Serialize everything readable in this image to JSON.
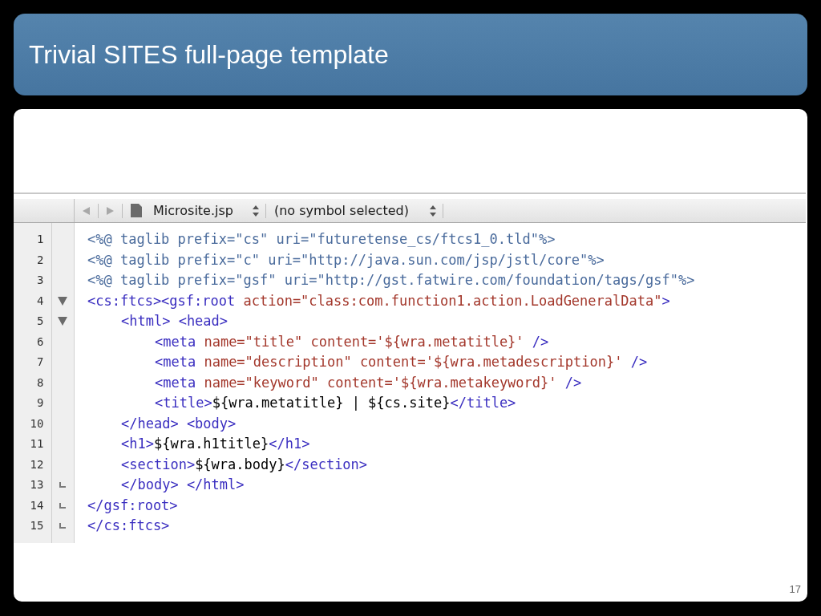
{
  "slide": {
    "title": "Trivial SITES full-page template",
    "page_number": "17"
  },
  "editor": {
    "toolbar": {
      "file_name": "Microsite.jsp",
      "symbol": "(no symbol selected)"
    },
    "lines": [
      {
        "number": "1",
        "foldable": false,
        "fold_end": false,
        "tokens": [
          {
            "kind": "directive",
            "text": "<%@ taglib prefix=\"cs\" uri=\"futuretense_cs/ftcs1_0.tld\"%>"
          }
        ]
      },
      {
        "number": "2",
        "foldable": false,
        "fold_end": false,
        "tokens": [
          {
            "kind": "directive",
            "text": "<%@ taglib prefix=\"c\" uri=\"http://java.sun.com/jsp/jstl/core\"%>"
          }
        ]
      },
      {
        "number": "3",
        "foldable": false,
        "fold_end": false,
        "tokens": [
          {
            "kind": "directive",
            "text": "<%@ taglib prefix=\"gsf\" uri=\"http://gst.fatwire.com/foundation/tags/gsf\"%>"
          }
        ]
      },
      {
        "number": "4",
        "foldable": true,
        "fold_end": false,
        "tokens": [
          {
            "kind": "tag",
            "text": "<cs:ftcs><gsf:root"
          },
          {
            "kind": "attr",
            "text": " action=\"class:com.function1.action.LoadGeneralData\""
          },
          {
            "kind": "tag",
            "text": ">"
          }
        ],
        "children": [
          {
            "number": "5",
            "foldable": true,
            "fold_end": false,
            "tokens": [
              {
                "kind": "tag",
                "text": "<html> <head>"
              }
            ],
            "children": [
              {
                "number": "6",
                "foldable": false,
                "fold_end": false,
                "tokens": [
                  {
                    "kind": "tag",
                    "text": "<meta"
                  },
                  {
                    "kind": "attr",
                    "text": " name=\"title\" content='${wra.metatitle}'"
                  },
                  {
                    "kind": "tag",
                    "text": " />"
                  }
                ]
              },
              {
                "number": "7",
                "foldable": false,
                "fold_end": false,
                "tokens": [
                  {
                    "kind": "tag",
                    "text": "<meta"
                  },
                  {
                    "kind": "attr",
                    "text": " name=\"description\" content='${wra.metadescription}'"
                  },
                  {
                    "kind": "tag",
                    "text": " />"
                  }
                ]
              },
              {
                "number": "8",
                "foldable": false,
                "fold_end": false,
                "tokens": [
                  {
                    "kind": "tag",
                    "text": "<meta"
                  },
                  {
                    "kind": "attr",
                    "text": " name=\"keyword\" content='${wra.metakeyword}'"
                  },
                  {
                    "kind": "tag",
                    "text": " />"
                  }
                ]
              },
              {
                "number": "9",
                "foldable": false,
                "fold_end": false,
                "tokens": [
                  {
                    "kind": "tag",
                    "text": "<title>"
                  },
                  {
                    "kind": "text",
                    "text": "${wra.metatitle} | ${cs.site}"
                  },
                  {
                    "kind": "tag",
                    "text": "</title>"
                  }
                ]
              }
            ]
          },
          {
            "number": "10",
            "foldable": false,
            "fold_end": false,
            "tokens": [
              {
                "kind": "tag",
                "text": "</head> <body>"
              }
            ]
          },
          {
            "number": "11",
            "foldable": false,
            "fold_end": false,
            "tokens": [
              {
                "kind": "tag",
                "text": "<h1>"
              },
              {
                "kind": "text",
                "text": "${wra.h1title}"
              },
              {
                "kind": "tag",
                "text": "</h1>"
              }
            ]
          },
          {
            "number": "12",
            "foldable": false,
            "fold_end": false,
            "tokens": [
              {
                "kind": "tag",
                "text": "<section>"
              },
              {
                "kind": "text",
                "text": "${wra.body}"
              },
              {
                "kind": "tag",
                "text": "</section>"
              }
            ]
          },
          {
            "number": "13",
            "foldable": false,
            "fold_end": true,
            "tokens": [
              {
                "kind": "tag",
                "text": "</body> </html>"
              }
            ]
          }
        ]
      },
      {
        "number": "14",
        "foldable": false,
        "fold_end": true,
        "tokens": [
          {
            "kind": "tag",
            "text": "</gsf:root>"
          }
        ]
      },
      {
        "number": "15",
        "foldable": false,
        "fold_end": true,
        "tokens": [
          {
            "kind": "tag",
            "text": "</cs:ftcs>"
          }
        ]
      }
    ]
  }
}
